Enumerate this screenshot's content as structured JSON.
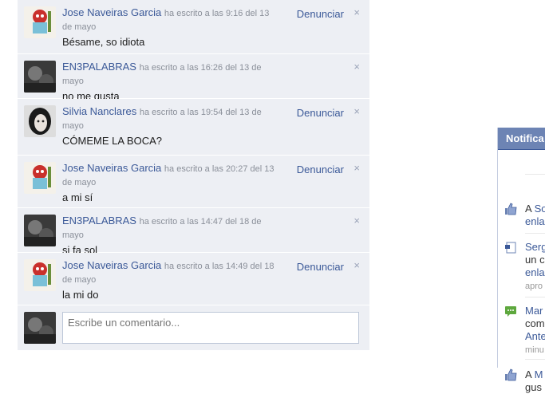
{
  "comments": [
    {
      "author": "Jose Naveiras Garcia",
      "when": "ha escrito a las 9:16 del 13 de mayo",
      "text": "Bésame, so idiota",
      "report": "Denunciar",
      "avatar": "monster"
    },
    {
      "author": "EN3PALABRAS",
      "when": "ha escrito a las 16:26 del 13 de mayo",
      "text": "no me gusta",
      "report": "",
      "avatar": "dark"
    },
    {
      "author": "Silvia Nanclares",
      "when": "ha escrito a las 19:54 del 13 de mayo",
      "text": "CÓMEME LA BOCA?",
      "report": "Denunciar",
      "avatar": "girl"
    },
    {
      "author": "Jose Naveiras Garcia",
      "when": "ha escrito a las 20:27 del 13 de mayo",
      "text": "a mi sí",
      "report": "Denunciar",
      "avatar": "monster"
    },
    {
      "author": "EN3PALABRAS",
      "when": "ha escrito a las 14:47 del 18 de mayo",
      "text": "si fa sol",
      "report": "",
      "avatar": "dark"
    },
    {
      "author": "Jose Naveiras Garcia",
      "when": "ha escrito a las 14:49 del 18 de mayo",
      "text": "la mi do",
      "report": "Denunciar",
      "avatar": "monster"
    }
  ],
  "compose": {
    "placeholder": "Escribe un comentario..."
  },
  "close_glyph": "×",
  "notifications": {
    "title": "Notifica",
    "items": [
      {
        "icon": "thumbs-up-icon",
        "line1_pre": "A ",
        "line1_link": "So",
        "line2": "enla",
        "time": ""
      },
      {
        "icon": "note-icon",
        "line1_pre": "",
        "line1_link": "Serg",
        "line2": "un c",
        "line3": "enla",
        "time": "apro"
      },
      {
        "icon": "comment-icon",
        "line1_pre": "",
        "line1_link": "Mar",
        "line2": "com",
        "line3": "Ante",
        "time": "minu"
      },
      {
        "icon": "thumbs-up-icon",
        "line1_pre": "A ",
        "line1_link": "M",
        "line2": "gus",
        "time": ""
      }
    ]
  },
  "colors": {
    "link": "#3b5998",
    "panel": "#edeff4",
    "header": "#6d84b4"
  }
}
